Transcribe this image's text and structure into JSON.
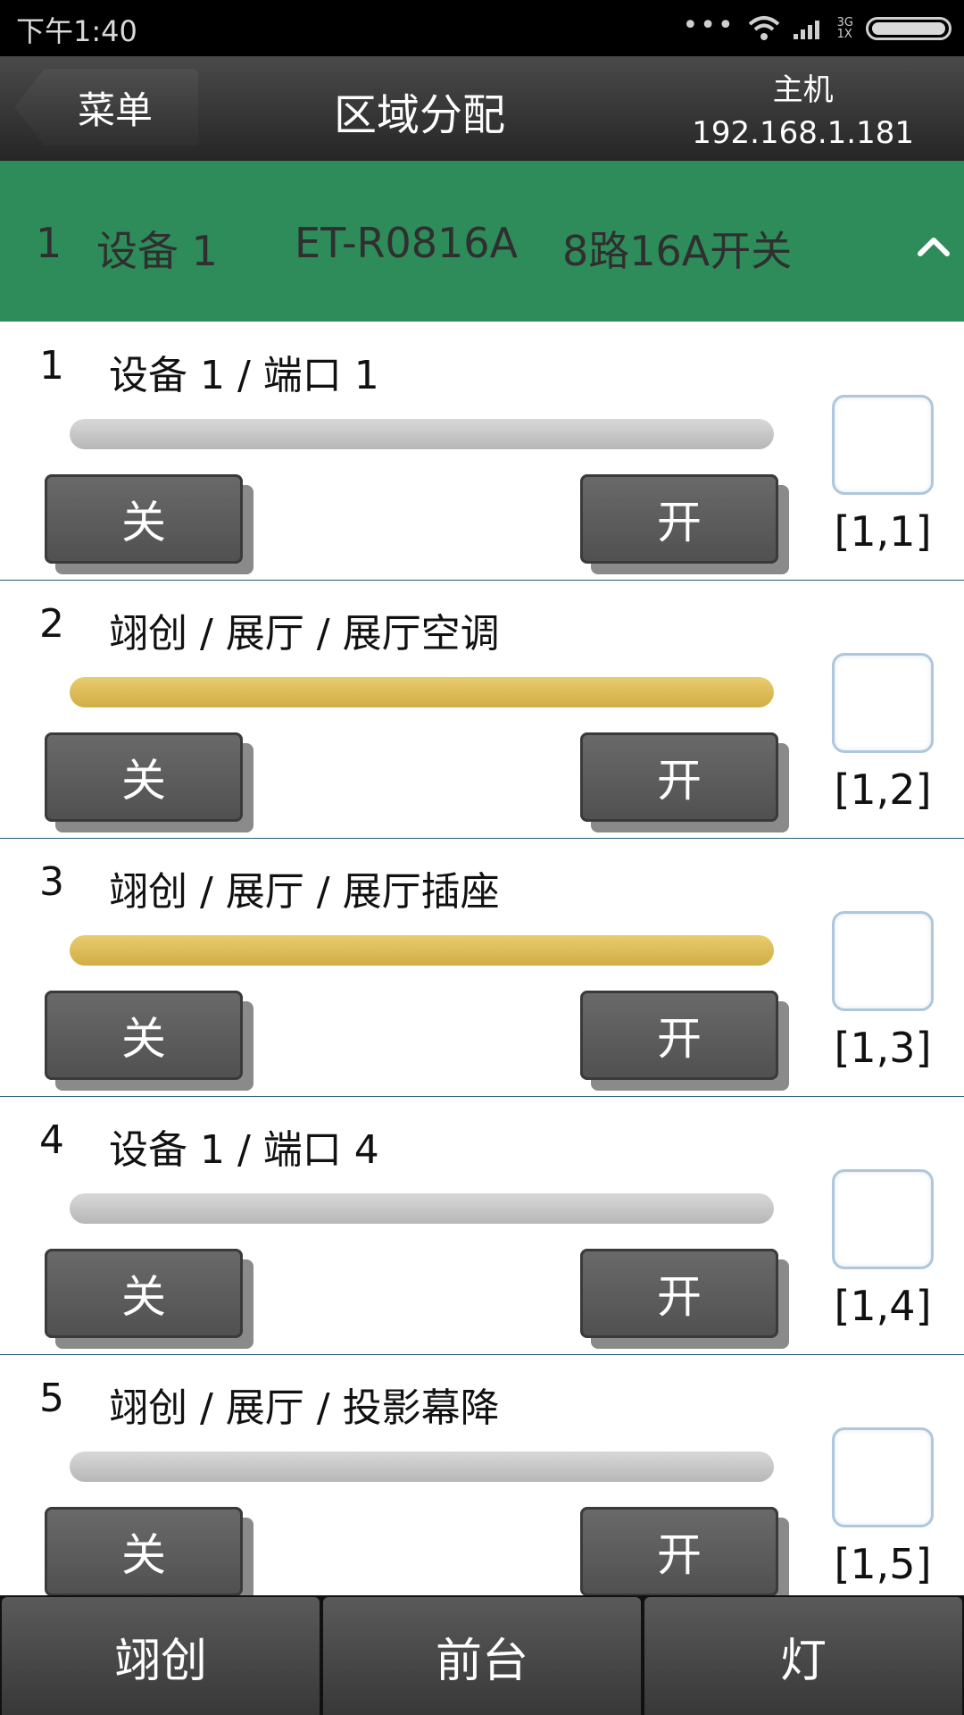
{
  "status_bar": {
    "time": "下午1:40",
    "dots": "•••",
    "network_top": "3G",
    "network_bottom": "1X"
  },
  "header": {
    "back_label": "菜单",
    "title": "区域分配",
    "host_label": "主机",
    "host_ip": "192.168.1.181"
  },
  "group": {
    "index": "1",
    "device_name": "设备 1",
    "model": "ET-R0816A",
    "description": "8路16A开关"
  },
  "rows": [
    {
      "num": "1",
      "name": "设备 1 / 端口 1",
      "state": "off",
      "off_label": "关",
      "on_label": "开",
      "coord": "[1,1]"
    },
    {
      "num": "2",
      "name": "翊创 / 展厅 / 展厅空调",
      "state": "on",
      "off_label": "关",
      "on_label": "开",
      "coord": "[1,2]"
    },
    {
      "num": "3",
      "name": "翊创 / 展厅 / 展厅插座",
      "state": "on",
      "off_label": "关",
      "on_label": "开",
      "coord": "[1,3]"
    },
    {
      "num": "4",
      "name": "设备 1 / 端口 4",
      "state": "off",
      "off_label": "关",
      "on_label": "开",
      "coord": "[1,4]"
    },
    {
      "num": "5",
      "name": "翊创 / 展厅 / 投影幕降",
      "state": "off",
      "off_label": "关",
      "on_label": "开",
      "coord": "[1,5]"
    }
  ],
  "tabs": [
    {
      "label": "翊创"
    },
    {
      "label": "前台"
    },
    {
      "label": "灯"
    }
  ],
  "colors": {
    "group_bg": "#2e8b5a",
    "bar_on": "#d9b955",
    "bar_off": "#c6c6c6"
  }
}
